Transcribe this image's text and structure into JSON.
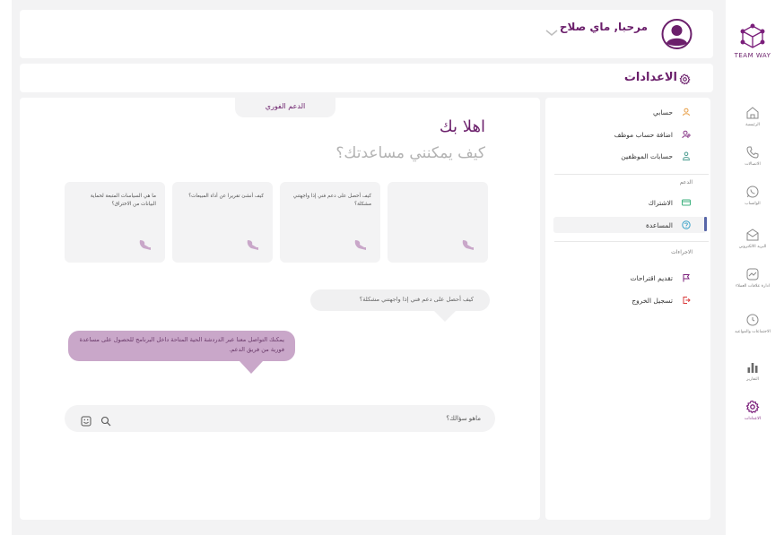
{
  "header": {
    "greeting": "مرحبا, ماي صلاح"
  },
  "title": {
    "text": "الاعدادات"
  },
  "logo": {
    "text": "TEAM WAY"
  },
  "rail": {
    "items": [
      {
        "label": "الرئيسية",
        "icon": "home-icon"
      },
      {
        "label": "الاتصالات",
        "icon": "phone-icon"
      },
      {
        "label": "الواتساب",
        "icon": "whatsapp-icon"
      },
      {
        "label": "البريد الالكتروني",
        "icon": "mail-icon"
      },
      {
        "label": "ادارة علاقات العملاء",
        "icon": "crm-icon"
      },
      {
        "label": "الاجتماعات والمواعيد",
        "icon": "clock-icon"
      },
      {
        "label": "التقارير",
        "icon": "bar-chart-icon"
      },
      {
        "label": "الاعدادات",
        "icon": "gear-icon"
      }
    ]
  },
  "settings_menu": {
    "account": "حسابي",
    "add_employee": "اضافة حساب موظف",
    "employee_accounts": "حسابات الموظفين",
    "support_section": "الدعم",
    "subscription": "الاشتراك",
    "help": "المساعدة",
    "actions_section": "الاجراءات",
    "suggestions": "تقديم اقتراحات",
    "logout": "تسجيل الخروج"
  },
  "help_page": {
    "live_support_tab": "الدعم الفوري",
    "hello": "اهلا بك",
    "how_can_help": "كيف يمكنني مساعدتك؟",
    "faq": [
      "ما هي السياسات المتبعة لحماية البيانات من الاختراق؟",
      "كيف أنشئ تقريرا عن أداء المبيعات؟",
      "كيف أحصل على دعم فني إذا واجهتني مشكلة؟",
      ""
    ],
    "question_bubble": "كيف أحصل على دعم فني إذا واجهتني مشكلة؟",
    "answer_bubble": "يمكنك التواصل معنا عبر الدردشة الحية المتاحة داخل البرنامج للحصول على مساعدة فورية من فريق الدعم.",
    "input_placeholder": "ماهو سؤالك؟"
  },
  "colors": {
    "brand": "#6b1f6b",
    "active_bar": "#5866a8",
    "answer_bubble": "#c9a7c9"
  }
}
